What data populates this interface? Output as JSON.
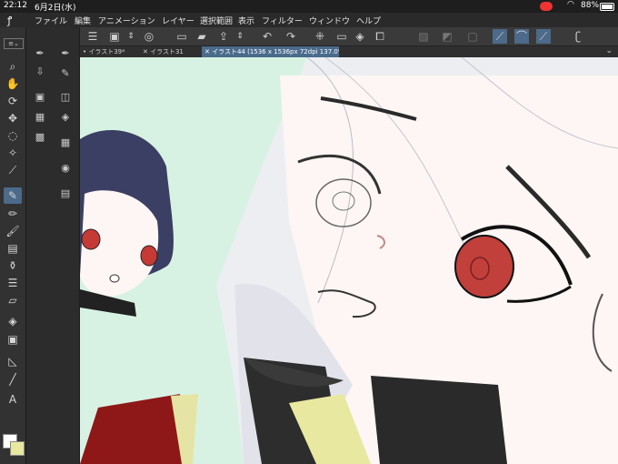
{
  "status": {
    "time": "22:12",
    "date": "6月2日(水)",
    "battery": "88%"
  },
  "menu": {
    "logo_icon": "clip-studio-logo-icon",
    "items": [
      "ファイル",
      "編集",
      "アニメーション",
      "レイヤー",
      "選択範囲",
      "表示",
      "フィルター",
      "ウィンドウ",
      "ヘルプ"
    ]
  },
  "tabs": [
    {
      "label": "• イラスト39*",
      "active": false
    },
    {
      "label": "✕ イラスト31",
      "active": false
    },
    {
      "label": "✕ イラスト44 (1536 x 1536px 72dpi 137.0%)",
      "active": true
    }
  ],
  "tools": {
    "selected": "pen",
    "list": [
      "zoom-icon",
      "hand-icon",
      "rotate-icon",
      "move-icon",
      "lasso-icon",
      "magic-wand-icon",
      "eyedropper-icon",
      "pen-icon",
      "pencil-icon",
      "brush-icon",
      "airbrush-icon",
      "decoration-icon",
      "eraser-icon",
      "fill-icon",
      "gradient-icon",
      "figure-icon",
      "line-icon",
      "text-icon"
    ]
  },
  "colors": {
    "main": "#ffffff",
    "sub": "#e8e8a0",
    "accent": "#4c6a8a",
    "canvas_bg": "#d7f2e3"
  }
}
